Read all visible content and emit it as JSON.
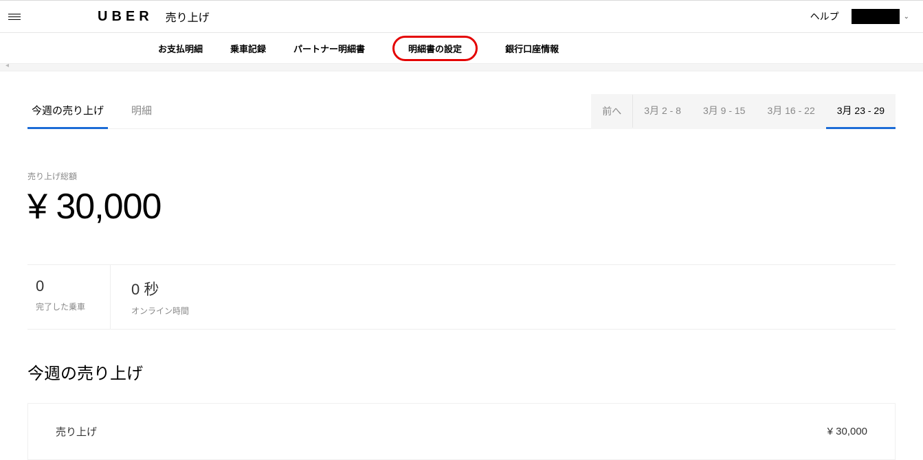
{
  "header": {
    "logo": "UBER",
    "page_title": "売り上げ",
    "help": "ヘルプ"
  },
  "subnav": {
    "items": [
      "お支払明細",
      "乗車記録",
      "パートナー明細書",
      "明細書の設定",
      "銀行口座情報"
    ]
  },
  "tabs": {
    "left": [
      {
        "label": "今週の売り上げ",
        "active": true
      },
      {
        "label": "明細",
        "active": false
      }
    ],
    "prev": "前へ",
    "dates": [
      {
        "label": "3月 2 - 8",
        "active": false
      },
      {
        "label": "3月 9 - 15",
        "active": false
      },
      {
        "label": "3月 16 - 22",
        "active": false
      },
      {
        "label": "3月 23 - 29",
        "active": true
      }
    ]
  },
  "totals": {
    "label": "売り上げ総額",
    "amount": "¥ 30,000"
  },
  "stats": {
    "completed_value": "0",
    "completed_label": "完了した乗車",
    "online_value": "0 秒",
    "online_label": "オンライン時間"
  },
  "section": {
    "title": "今週の売り上げ",
    "row_label": "売り上げ",
    "row_amount": "¥ 30,000"
  }
}
